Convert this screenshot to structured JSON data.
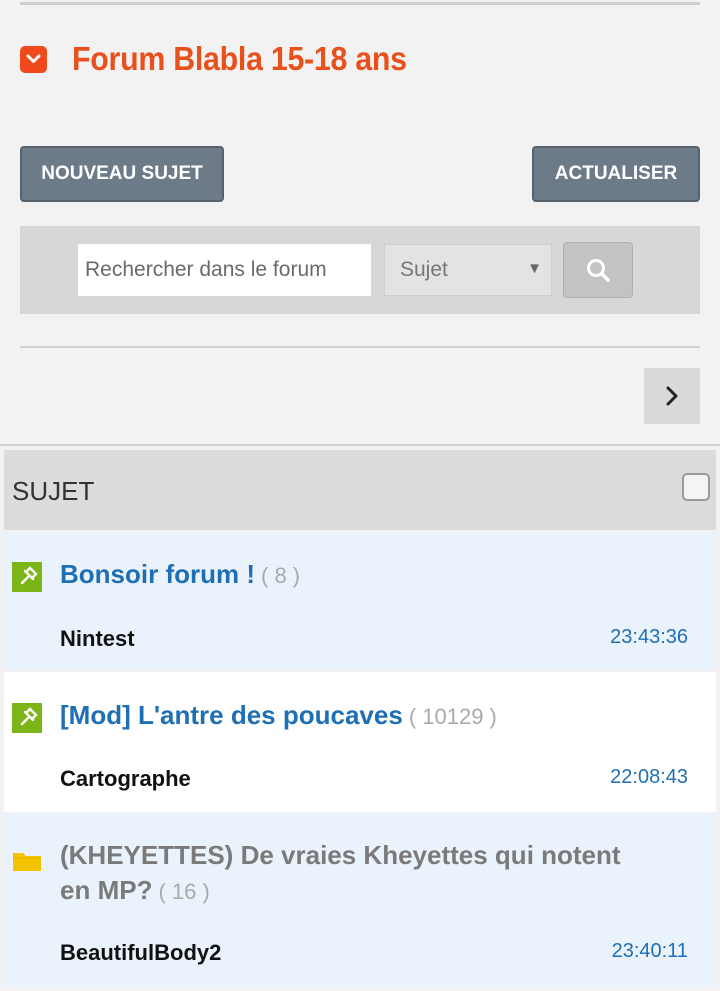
{
  "forum": {
    "title": "Forum Blabla 15-18 ans"
  },
  "toolbar": {
    "new_topic_label": "NOUVEAU SUJET",
    "refresh_label": "ACTUALISER"
  },
  "search": {
    "placeholder": "Rechercher dans le forum",
    "value": "",
    "scope_selected": "Sujet"
  },
  "list": {
    "header_label": "SUJET",
    "topics": [
      {
        "title": "Bonsoir forum !",
        "count": "( 8 )",
        "author": "Nintest",
        "time": "23:43:36",
        "icon": "pin-icon",
        "style": "link"
      },
      {
        "title": "[Mod] L'antre des poucaves",
        "count": "( 10129 )",
        "author": "Cartographe",
        "time": "22:08:43",
        "icon": "pin-icon",
        "style": "link"
      },
      {
        "title_line1": "(KHEYETTES) De vraies Kheyettes qui notent",
        "title_line2": "en MP?",
        "count": "( 16 )",
        "author": "BeautifulBody2",
        "time": "23:40:11",
        "icon": "folder-icon",
        "style": "grey"
      }
    ]
  },
  "colors": {
    "accent": "#e9511c",
    "link": "#1f6fb5",
    "button": "#6d7b89",
    "pin_green": "#7cb518",
    "folder_yellow": "#f5c400"
  }
}
